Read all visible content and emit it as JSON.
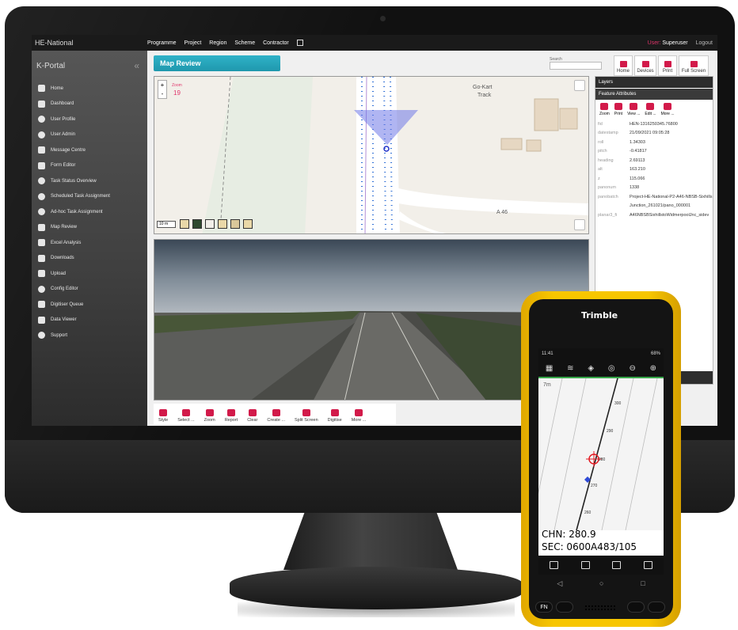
{
  "app": {
    "brand": "HE-National",
    "nav": [
      "Programme",
      "Project",
      "Region",
      "Scheme",
      "Contractor"
    ],
    "user_label": "User:",
    "user_name": "Superuser",
    "logout": "Logout"
  },
  "sidebar": {
    "title": "K-Portal",
    "collapse_glyph": "«",
    "items": [
      {
        "label": "Home"
      },
      {
        "label": "Dashboard"
      },
      {
        "label": "User Profile"
      },
      {
        "label": "User Admin"
      },
      {
        "label": "Message Centre"
      },
      {
        "label": "Form Editor"
      },
      {
        "label": "Task Status Overview"
      },
      {
        "label": "Scheduled Task Assignment"
      },
      {
        "label": "Ad-hoc Task Assignment"
      },
      {
        "label": "Map Review"
      },
      {
        "label": "Excel Analysis"
      },
      {
        "label": "Downloads"
      },
      {
        "label": "Upload"
      },
      {
        "label": "Config Editor"
      },
      {
        "label": "Digitiser Queue"
      },
      {
        "label": "Data Viewer"
      },
      {
        "label": "Support"
      }
    ]
  },
  "header": {
    "page_tab": "Map Review",
    "search_label": "Search",
    "buttons": [
      "Home",
      "Devices",
      "Print",
      "Full Screen"
    ]
  },
  "map": {
    "zoom_plus": "+",
    "zoom_minus": "-",
    "zoom_label": "Zoom",
    "zoom_value": "19",
    "labels": [
      "Go-Kart",
      "Track",
      "A 46"
    ],
    "scale": "10 m"
  },
  "toolbar": {
    "buttons": [
      "Style",
      "Select ...",
      "Zoom",
      "Report",
      "Clear",
      "Create ...",
      "Split Screen",
      "Digitise",
      "More ..."
    ]
  },
  "attributes": {
    "layers_title": "Layers",
    "feature_title": "Feature Attributes",
    "tools": [
      "Zoom",
      "Print",
      "View ...",
      "Edit ...",
      "More ..."
    ],
    "rows": [
      {
        "key": "fid",
        "value": "HEN-1316250345.76800"
      },
      {
        "key": "datestamp",
        "value": "21/09/2021 09:05:28"
      },
      {
        "key": "roll",
        "value": "1.34303"
      },
      {
        "key": "pitch",
        "value": "-0.41817"
      },
      {
        "key": "heading",
        "value": "2.69113"
      },
      {
        "key": "alt",
        "value": "163.210"
      },
      {
        "key": "z",
        "value": "115.066"
      },
      {
        "key": "panonum",
        "value": "1338"
      },
      {
        "key": "panobatch",
        "value": "Project-HE-National-P2-A46-NBSB-Sixhills"
      },
      {
        "key": "",
        "value": "Junction_261021/pano_000001"
      },
      {
        "key": "planar3_fi",
        "value": "A46NBSBSixhillstoWidmerpoolJnc_sidev"
      }
    ]
  },
  "phone": {
    "brand": "Trimble",
    "status_time": "11:41",
    "status_right": "68%",
    "map_unit": "7m",
    "chainage": "CHN: 280.9",
    "section": "SEC: 0600A483/105",
    "tick_labels": [
      "300",
      "290",
      "280",
      "270",
      "260"
    ],
    "keys": [
      "FN"
    ]
  },
  "colors": {
    "accent": "#d21a4a",
    "tab": "#1f98ad",
    "phone_body": "#f7c600",
    "route": "#2f6fd6"
  }
}
